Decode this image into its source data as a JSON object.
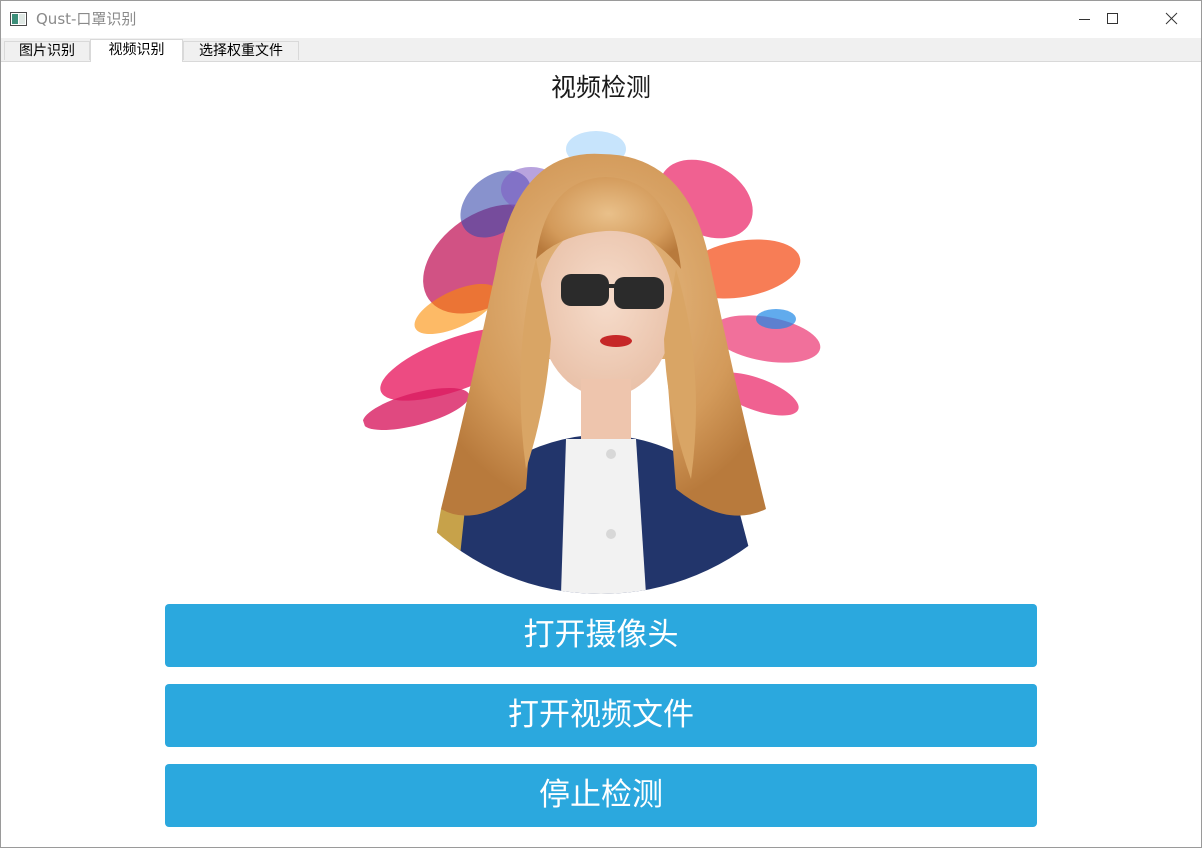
{
  "window": {
    "title": "Qust-口罩识别",
    "controls": [
      "minimize",
      "maximize",
      "close"
    ]
  },
  "tabs": [
    {
      "label": "图片识别",
      "active": false
    },
    {
      "label": "视频识别",
      "active": true
    },
    {
      "label": "选择权重文件",
      "active": false
    }
  ],
  "panel": {
    "title": "视频检测",
    "image_description_icon": "portrait-image"
  },
  "buttons": {
    "open_camera": "打开摄像头",
    "open_video": "打开视频文件",
    "stop_detect": "停止检测"
  },
  "colors": {
    "button_bg": "#2ba8de",
    "button_text": "#ffffff",
    "tabbar_bg": "#f0f0f0"
  }
}
